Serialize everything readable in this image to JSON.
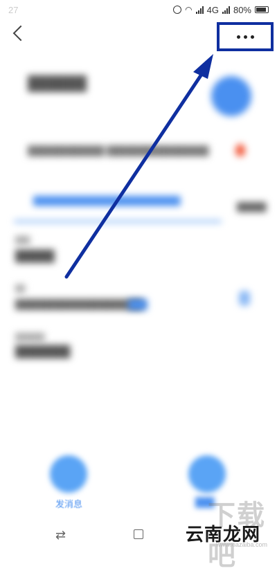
{
  "status_bar": {
    "time": "27",
    "network": "4G",
    "battery": "80%",
    "icons": [
      "alarm-clock-icon",
      "wifi-icon",
      "signal-icon",
      "battery-icon"
    ]
  },
  "nav": {
    "back_icon": "chevron-left-icon",
    "more_icon": "more-dots-icon"
  },
  "profile": {
    "name": "",
    "description": "",
    "tip": "",
    "side_label": "",
    "fields": [
      {
        "label": "",
        "value": ""
      },
      {
        "label": "",
        "value": "",
        "link": ""
      },
      {
        "label": "",
        "value": ""
      }
    ]
  },
  "actions": {
    "send_message_label": "发消息",
    "call_label": ""
  },
  "watermark": {
    "main": "云南龙网",
    "background": "下载吧",
    "domain": "www.xiazaiba.com"
  },
  "colors": {
    "highlight": "#0f2fa0",
    "accent": "#4a90f0"
  }
}
